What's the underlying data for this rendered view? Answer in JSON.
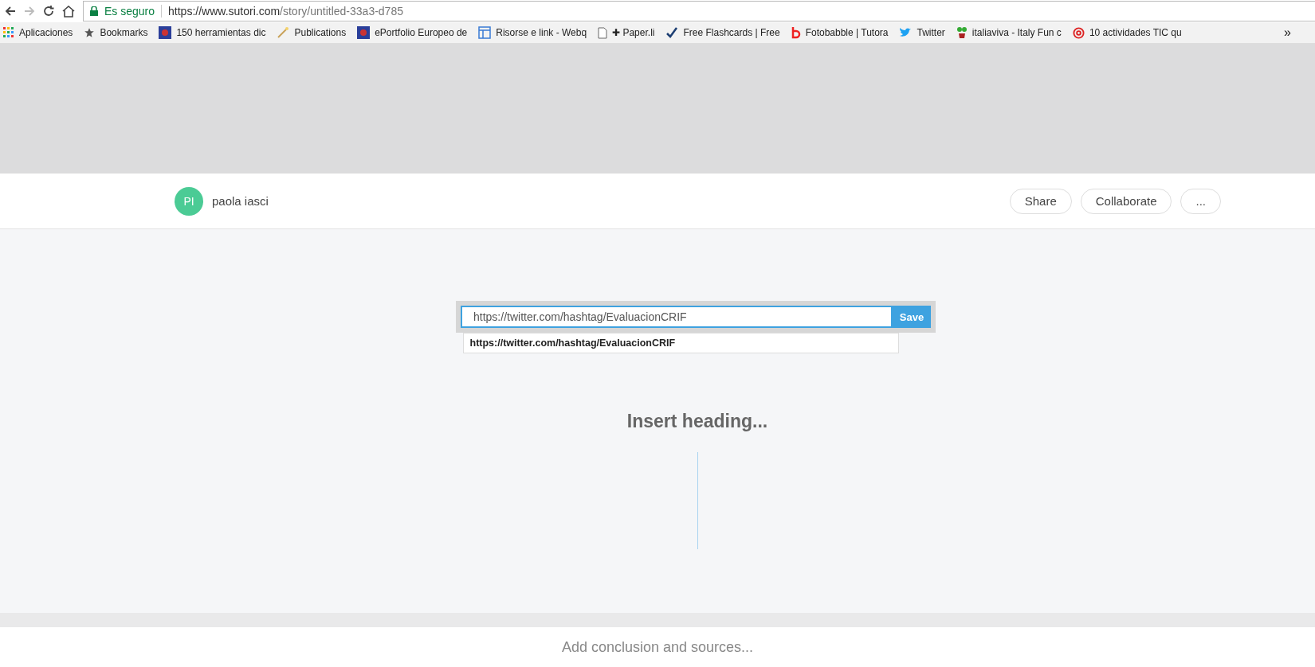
{
  "browser": {
    "security": "Es seguro",
    "url_host": "https://www.sutori.com",
    "url_path": "/story/untitled-33a3-d785"
  },
  "bookmarks": [
    {
      "kind": "apps",
      "label": "Aplicaciones"
    },
    {
      "kind": "star",
      "label": "Bookmarks"
    },
    {
      "kind": "image",
      "label": "150 herramientas dic"
    },
    {
      "kind": "wand",
      "label": "Publications"
    },
    {
      "kind": "image",
      "label": "ePortfolio Europeo de"
    },
    {
      "kind": "layout",
      "label": "Risorse e link - Webq"
    },
    {
      "kind": "page",
      "label": "✚ Paper.li"
    },
    {
      "kind": "check",
      "label": "Free Flashcards | Free"
    },
    {
      "kind": "letter",
      "label": "Fotobabble | Tutora"
    },
    {
      "kind": "bird",
      "label": "Twitter"
    },
    {
      "kind": "plant",
      "label": "italiaviva - Italy Fun c"
    },
    {
      "kind": "at",
      "label": "10 actividades TIC qu"
    }
  ],
  "bookmarks_more": "»",
  "header": {
    "avatar": "PI",
    "user": "paola iasci",
    "buttons": [
      "Share",
      "Collaborate",
      "..."
    ]
  },
  "link_editor": {
    "value": "https://twitter.com/hashtag/EvaluacionCRIF",
    "save": "Save",
    "suggestion": "https://twitter.com/hashtag/EvaluacionCRIF"
  },
  "heading_placeholder": "Insert heading...",
  "footer_placeholder": "Add conclusion and sources..."
}
